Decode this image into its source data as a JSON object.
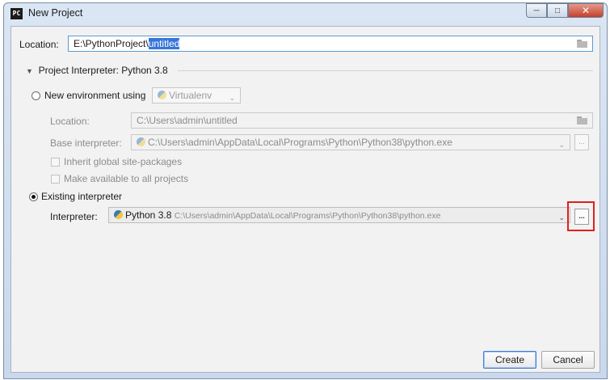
{
  "window": {
    "title": "New Project",
    "app_icon": "PC"
  },
  "location": {
    "label": "Location:",
    "prefix": "E:\\PythonProject\\",
    "selected": "untitled"
  },
  "interpreter_section": {
    "title": "Project Interpreter: Python 3.8"
  },
  "new_env": {
    "radio_label": "New environment using",
    "tool": "Virtualenv",
    "location_label": "Location:",
    "location_value": "C:\\Users\\admin\\untitled",
    "base_label": "Base interpreter:",
    "base_value": "C:\\Users\\admin\\AppData\\Local\\Programs\\Python\\Python38\\python.exe",
    "inherit_label": "Inherit global site-packages",
    "available_label": "Make available to all projects"
  },
  "existing": {
    "radio_label": "Existing interpreter",
    "interpreter_label": "Interpreter:",
    "interpreter_name": "Python 3.8",
    "interpreter_path": "C:\\Users\\admin\\AppData\\Local\\Programs\\Python\\Python38\\python.exe",
    "browse_label": "..."
  },
  "buttons": {
    "create": "Create",
    "cancel": "Cancel"
  },
  "colors": {
    "highlight": "#e0201b",
    "selection": "#3874d8",
    "focus_border": "#5b9bd5"
  },
  "icons": {
    "app": "pycharm-icon",
    "folder": "folder-icon",
    "python": "python-icon",
    "virtualenv": "virtualenv-icon",
    "dropdown": "chevron-down-icon"
  }
}
